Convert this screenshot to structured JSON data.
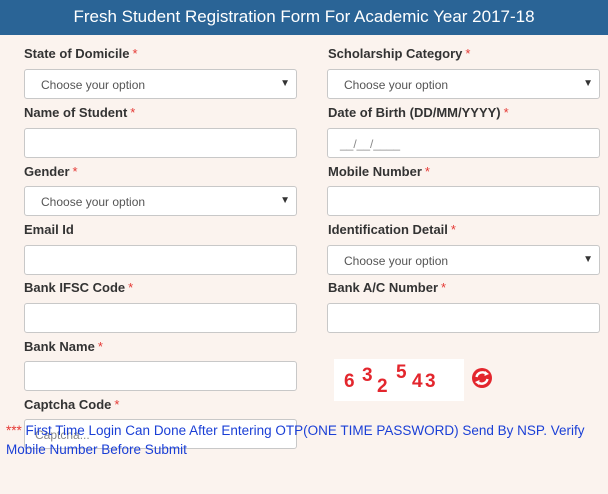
{
  "header": {
    "title": "Fresh Student Registration Form For Academic Year 2017-18"
  },
  "required_mark": "*",
  "fields": {
    "state_of_domicile": {
      "label": "State of Domicile",
      "value": "Choose your option"
    },
    "scholarship_category": {
      "label": "Scholarship Category",
      "value": "Choose your option"
    },
    "name_of_student": {
      "label": "Name of Student",
      "value": ""
    },
    "date_of_birth": {
      "label": "Date of Birth (DD/MM/YYYY)",
      "placeholder": "__/__/____"
    },
    "gender": {
      "label": "Gender",
      "value": "Choose your option"
    },
    "mobile_number": {
      "label": "Mobile Number",
      "value": ""
    },
    "email_id": {
      "label": "Email Id",
      "value": ""
    },
    "identification_detail": {
      "label": "Identification Detail",
      "value": "Choose your option"
    },
    "bank_ifsc_code": {
      "label": "Bank IFSC Code",
      "value": ""
    },
    "bank_ac_number": {
      "label": "Bank A/C Number",
      "value": ""
    },
    "bank_name": {
      "label": "Bank Name",
      "value": ""
    },
    "captcha_code": {
      "label": "Captcha Code",
      "placeholder": "Captcha..."
    }
  },
  "captcha": {
    "chars": [
      "6",
      "3",
      "2",
      "5",
      "4",
      "3"
    ],
    "color": "#e3262d"
  },
  "icons": {
    "refresh": "refresh-icon",
    "dropdown": "caret-down-icon"
  },
  "notice": {
    "stars": "***",
    "text": " First Time Login Can Done After Entering OTP(ONE TIME PASSWORD) Send By NSP. Verify Mobile Number Before Submit"
  },
  "colors": {
    "header_bg": "#2a6496",
    "required": "#e53935",
    "notice": "#1a3fd6",
    "page_bg": "#fbf3ee"
  }
}
